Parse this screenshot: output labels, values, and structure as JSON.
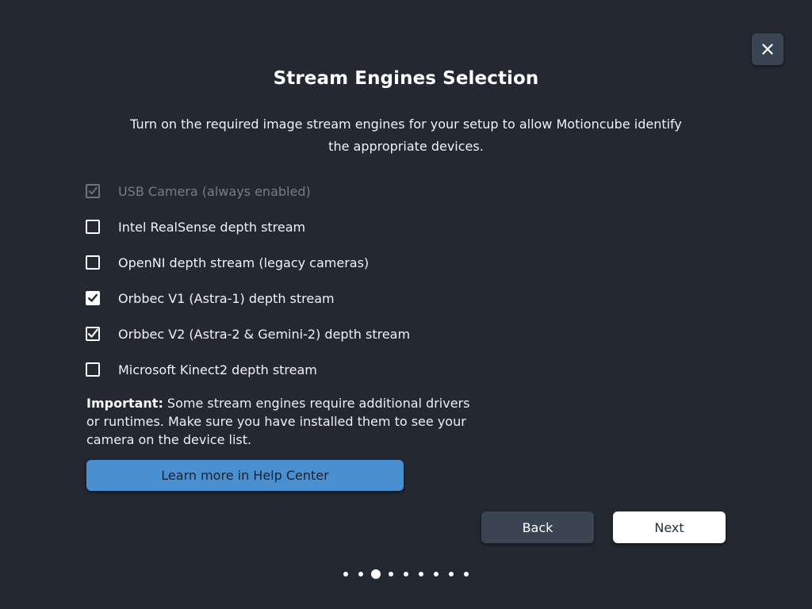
{
  "dialog": {
    "title": "Stream Engines Selection",
    "description": "Turn on the required image stream engines for your setup to allow Motioncube identify the appropriate devices.",
    "close_icon": "close-icon"
  },
  "options": [
    {
      "label": "USB Camera (always enabled)",
      "checked": true,
      "disabled": true
    },
    {
      "label": "Intel RealSense depth stream",
      "checked": false,
      "disabled": false
    },
    {
      "label": "OpenNI depth stream (legacy cameras)",
      "checked": false,
      "disabled": false
    },
    {
      "label": "Orbbec V1 (Astra-1) depth stream",
      "checked": true,
      "disabled": false
    },
    {
      "label": "Orbbec V2 (Astra-2 & Gemini-2) depth stream",
      "checked": true,
      "disabled": false
    },
    {
      "label": "Microsoft Kinect2 depth stream",
      "checked": false,
      "disabled": false
    }
  ],
  "note": {
    "bold": "Important:",
    "text": " Some stream engines require additional drivers or runtimes. Make sure you have installed them to see your camera on the device list."
  },
  "help_button_label": "Learn more in Help Center",
  "nav": {
    "back_label": "Back",
    "next_label": "Next"
  },
  "pager": {
    "total": 9,
    "current": 3
  },
  "colors": {
    "background": "#232831",
    "accent": "#4a8fd0",
    "secondary_button": "#3a4452"
  }
}
